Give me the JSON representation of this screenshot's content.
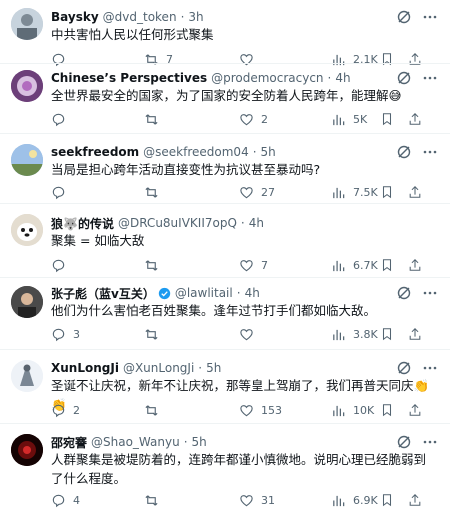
{
  "tweets": [
    {
      "name": "Baysky",
      "handle": "@dvd_token",
      "time": "3h",
      "text": "中共害怕人民以任何形式聚集",
      "replies": "",
      "reposts": "7",
      "likes": "",
      "views": "2.1K",
      "verified": false
    },
    {
      "name": "Chinese’s Perspectives",
      "handle": "@prodemocracycn",
      "time": "4h",
      "text": "全世界最安全的国家，为了国家的安全防着人民跨年，能理解😅",
      "replies": "",
      "reposts": "",
      "likes": "2",
      "views": "5K",
      "verified": false
    },
    {
      "name": "seekfreedom",
      "handle": "@seekfreedom04",
      "time": "5h",
      "text": "当局是担心跨年活动直接变性为抗议甚至暴动吗?",
      "replies": "",
      "reposts": "",
      "likes": "27",
      "views": "7.5K",
      "verified": false
    },
    {
      "name": "狼🐺的传说",
      "handle": "@DRCu8uIVKII7opQ",
      "time": "4h",
      "text": "聚集 = 如临大敌",
      "replies": "",
      "reposts": "",
      "likes": "7",
      "views": "6.7K",
      "verified": false
    },
    {
      "name": "张子彪（蓝v互关）",
      "handle": "@lawlitail",
      "time": "4h",
      "text": "他们为什么害怕老百姓聚集。逢年过节打手们都如临大敌。",
      "replies": "3",
      "reposts": "",
      "likes": "",
      "views": "3.8K",
      "verified": true
    },
    {
      "name": "XunLongJi",
      "handle": "@XunLongJi",
      "time": "5h",
      "text": "圣诞不让庆祝，新年不让庆祝，那等皇上驾崩了，我们再普天同庆👏👏",
      "replies": "2",
      "reposts": "",
      "likes": "153",
      "views": "10K",
      "verified": false
    },
    {
      "name": "邵宛謇",
      "handle": "@Shao_Wanyu",
      "time": "5h",
      "text": "人群聚集是被堤防着的，连跨年都谨小慎微地。说明心理已经脆弱到了什么程度。",
      "replies": "4",
      "reposts": "",
      "likes": "31",
      "views": "6.9K",
      "verified": false
    }
  ],
  "icons": {
    "reply": "reply-icon",
    "repost": "repost-icon",
    "like": "heart-icon",
    "views": "views-icon",
    "grok": "grok-icon",
    "more": "more-icon",
    "bookmark": "bookmark-icon",
    "share": "share-icon"
  },
  "colors": {
    "text": "#0f1419",
    "muted": "#536471",
    "separator": "#eff3f4",
    "verified": "#1d9bf0"
  }
}
